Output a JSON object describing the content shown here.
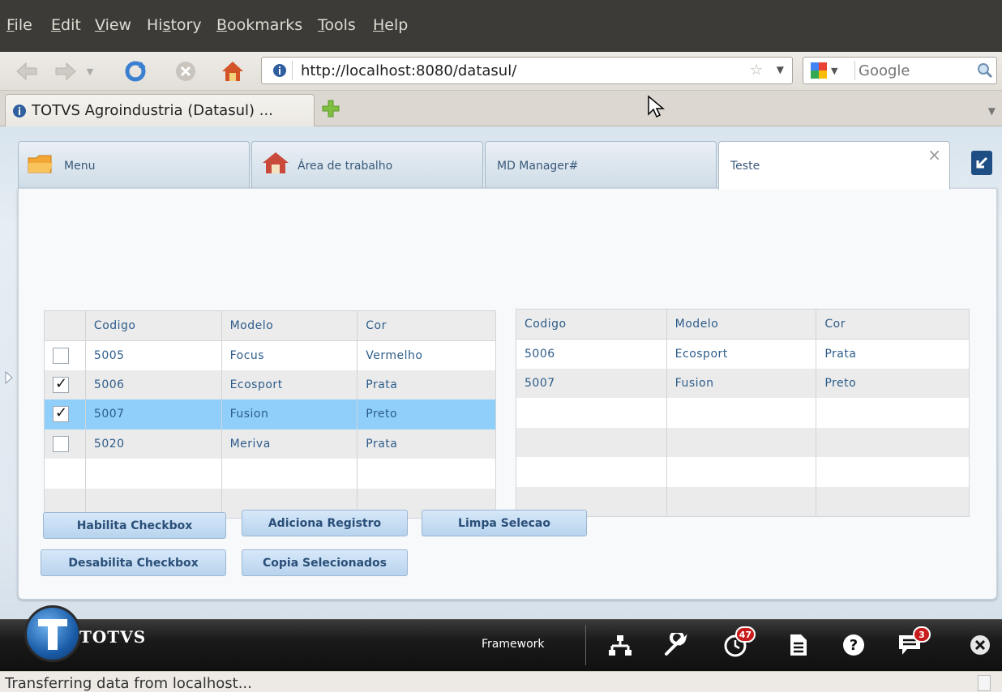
{
  "menubar": {
    "items": [
      "File",
      "Edit",
      "View",
      "History",
      "Bookmarks",
      "Tools",
      "Help"
    ],
    "underline": [
      "F",
      "E",
      "V",
      "s",
      "B",
      "T",
      "H"
    ]
  },
  "navbar": {
    "url": "http://localhost:8080/datasul/",
    "search_placeholder": "Google"
  },
  "browser_tab": {
    "title": "TOTVS Agroindustria (Datasul) ..."
  },
  "app_tabs": [
    {
      "label": "Menu",
      "icon": "folder-icon"
    },
    {
      "label": "Área de trabalho",
      "icon": "house-icon"
    },
    {
      "label": "MD Manager#",
      "icon": ""
    },
    {
      "label": "Teste",
      "icon": ""
    }
  ],
  "left_grid": {
    "headers": [
      "",
      "Codigo",
      "Modelo",
      "Cor"
    ],
    "rows": [
      {
        "checked": false,
        "selected": false,
        "codigo": "5005",
        "modelo": "Focus",
        "cor": "Vermelho"
      },
      {
        "checked": true,
        "selected": false,
        "codigo": "5006",
        "modelo": "Ecosport",
        "cor": "Prata"
      },
      {
        "checked": true,
        "selected": true,
        "codigo": "5007",
        "modelo": "Fusion",
        "cor": "Preto"
      },
      {
        "checked": false,
        "selected": false,
        "codigo": "5020",
        "modelo": "Meriva",
        "cor": "Prata"
      }
    ],
    "empty_rows": 2
  },
  "right_grid": {
    "headers": [
      "Codigo",
      "Modelo",
      "Cor"
    ],
    "rows": [
      {
        "codigo": "5006",
        "modelo": "Ecosport",
        "cor": "Prata"
      },
      {
        "codigo": "5007",
        "modelo": "Fusion",
        "cor": "Preto"
      }
    ],
    "empty_rows": 4
  },
  "buttons": {
    "habilita": "Habilita Checkbox",
    "adiciona": "Adiciona Registro",
    "limpa": "Limpa Selecao",
    "desabilita": "Desabilita Checkbox",
    "copia": "Copia Selecionados"
  },
  "footer": {
    "logo_text": "TOTVS",
    "framework_label": "Framework",
    "notifications_count": "47",
    "messages_count": "3"
  },
  "status": {
    "text": "Transferring data from localhost..."
  },
  "colors": {
    "selected_row": "#8fcffa",
    "badge": "#c81b1b",
    "accent_blue": "#1f4e84"
  }
}
